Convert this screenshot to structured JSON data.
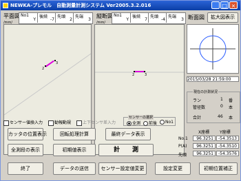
{
  "window": {
    "title": "NEWKA-プレモル　自動測量計測システム  Ver2005.3.2.016",
    "minimize_label": "_",
    "maximize_label": "□",
    "close_label": "×"
  },
  "plan_panel": {
    "label": "平面図",
    "unit": "/mm/",
    "cols": [
      {
        "head": "No1",
        "value": "Y"
      },
      {
        "head": "後続",
        "value": "-7"
      },
      {
        "head": "先頭",
        "value": "2"
      },
      {
        "head": "先端",
        "value": "3"
      }
    ],
    "points": [
      "2",
      "3"
    ]
  },
  "vertical_panel": {
    "label": "縦断図",
    "unit": "/mm/",
    "cols": [
      {
        "head": "No1",
        "value": "Y"
      },
      {
        "head": "後続",
        "value": "7"
      },
      {
        "head": "先頭",
        "value": "-4"
      },
      {
        "head": "先端",
        "value": "3"
      }
    ],
    "points": [
      "2",
      "3"
    ]
  },
  "section_panel": {
    "label": "断面図",
    "zoom_button": "拡大図表示",
    "datetime": "2015/03/28 21:59:00"
  },
  "status_group": {
    "title": "現在の計測状況",
    "rows": [
      {
        "label": "ラン",
        "value": "1",
        "unit": "番"
      },
      {
        "label": "管径数",
        "value": "0",
        "unit": "本"
      },
      {
        "label": "合計",
        "value": "46",
        "unit": "本"
      }
    ]
  },
  "coords": {
    "col_x": "X座標",
    "col_y": "Y座標",
    "rows": [
      {
        "label": "No.1",
        "x": "96.3251",
        "y": "-54.3513"
      },
      {
        "label": "P(A)",
        "x": "96.3251",
        "y": "-54.3510"
      },
      {
        "label": "先頭",
        "x": "96.3251",
        "y": "-54.3576"
      }
    ]
  },
  "options": {
    "sensor_check": "センサー値換入力",
    "auto_check": "勧報動規",
    "manual_check": "上下センサ差入力",
    "radio_group_title": "センサーの選択",
    "radio_items": [
      "全測",
      "前後",
      "No1"
    ]
  },
  "buttons": {
    "current_position": "カッタの位置表示",
    "survey_calc": "回転処理計算",
    "last_data": "最終データ表示",
    "all_measure": "全測段の表示",
    "initial_calc": "初期値表示",
    "measure": "計　　測",
    "exit": "終了",
    "data_save": "データの送信",
    "sensor_correct": "センサー設定値変更",
    "settings": "設定変更",
    "init_correct": "初期位置補正"
  }
}
